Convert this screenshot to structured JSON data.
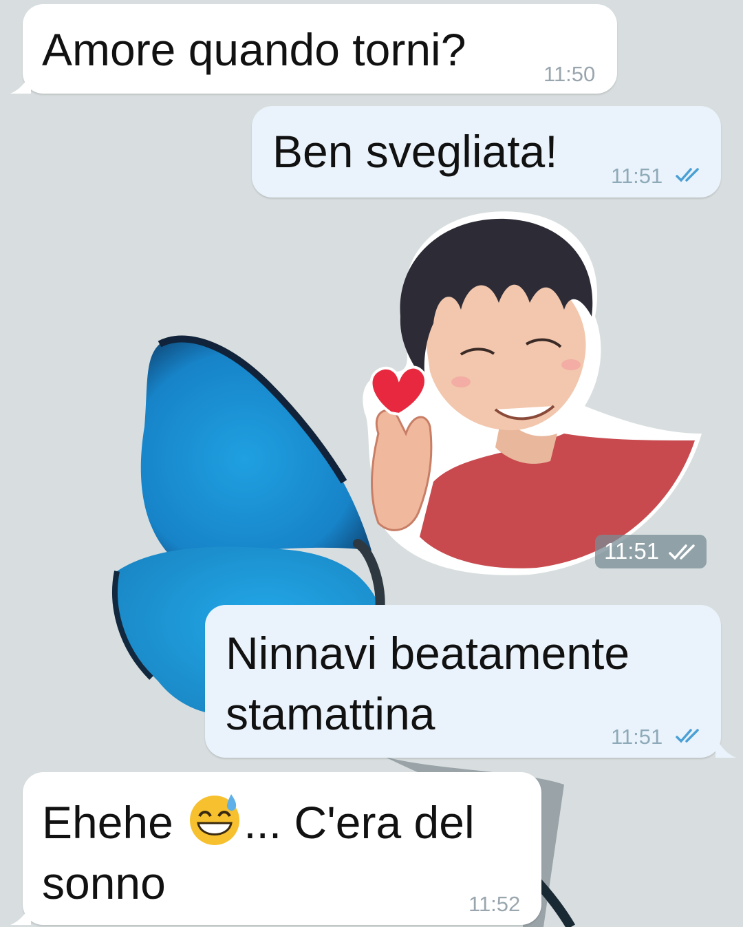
{
  "colors": {
    "incoming_bubble": "#ffffff",
    "outgoing_bubble": "#eaf3fb",
    "check_color": "#4aa0d6",
    "wallpaper": "#d9dfe0"
  },
  "messages": [
    {
      "direction": "incoming",
      "text": "Amore quando torni?",
      "time": "11:50"
    },
    {
      "direction": "outgoing",
      "text": "Ben svegliata!",
      "time": "11:51",
      "status": "double-check-icon"
    },
    {
      "direction": "outgoing",
      "type": "sticker",
      "sticker": "boy-finger-heart-sticker",
      "time": "11:51",
      "status": "double-check-icon"
    },
    {
      "direction": "outgoing",
      "text": "Ninnavi beatamente\nstamattina",
      "time": "11:51",
      "status": "double-check-icon"
    },
    {
      "direction": "incoming",
      "text_before": "Ehehe ",
      "emoji": "sweat-smile-emoji",
      "text_after": "... C'era del\nsonno",
      "time": "11:52"
    }
  ]
}
